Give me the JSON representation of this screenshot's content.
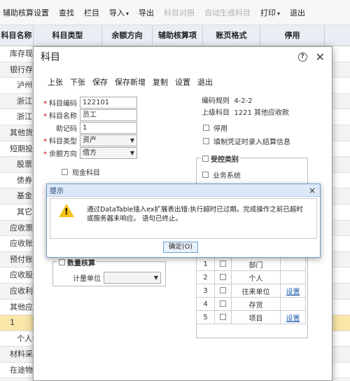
{
  "toolbar": {
    "items": [
      {
        "label": "辅助核算设置",
        "disabled": false,
        "caret": false
      },
      {
        "label": "查找",
        "disabled": false,
        "caret": false
      },
      {
        "label": "栏目",
        "disabled": false,
        "caret": false
      },
      {
        "label": "导入",
        "disabled": false,
        "caret": true
      },
      {
        "label": "导出",
        "disabled": false,
        "caret": false
      },
      {
        "label": "科目对照",
        "disabled": true,
        "caret": false
      },
      {
        "label": "自动生成科目",
        "disabled": true,
        "caret": false
      },
      {
        "label": "打印",
        "disabled": false,
        "caret": true
      },
      {
        "label": "退出",
        "disabled": false,
        "caret": false
      }
    ]
  },
  "grid": {
    "headers": [
      "科目名称",
      "科目类型",
      "余额方向",
      "辅助核算项",
      "账页格式",
      "停用"
    ],
    "rows": [
      "库存现金",
      "银行存款",
      "泸州商业银行",
      "浙江民泰银行",
      "浙江民泰银行",
      "其他货币资金",
      "短期投资",
      "股票",
      "债券",
      "基金",
      "其它",
      "应收票据",
      "应收账款",
      "预付账款",
      "应收股利",
      "应收利息",
      "其他应收款",
      "1",
      "个人往来",
      "材料采购",
      "在途物资",
      "原材料"
    ]
  },
  "dialog": {
    "title": "科目",
    "actions": [
      "上张",
      "下张",
      "保存",
      "保存新增",
      "复制",
      "设置",
      "退出"
    ],
    "form": {
      "code_label": "科目编码",
      "code_value": "122101",
      "name_label": "科目名称",
      "name_value": "员工",
      "mnemonic_label": "助记码",
      "mnemonic_value": "1",
      "type_label": "科目类型",
      "type_value": "资产",
      "direction_label": "余额方向",
      "direction_value": "借方",
      "cash_label": "现金科目"
    },
    "info": {
      "rule_label": "编码规则",
      "rule_value": "4-2-2",
      "parent_label": "上级科目",
      "parent_value": "1221 其他应收款",
      "disable_label": "停用",
      "voucher_label": "填制凭证时录入结算信息"
    },
    "quantity": {
      "group_label": "数量核算",
      "unit_label": "计量单位"
    },
    "control": {
      "group_label": "受控类别",
      "business_label": "业务系统",
      "rows": [
        {
          "num": "1",
          "name": "部门",
          "setting": ""
        },
        {
          "num": "2",
          "name": "个人",
          "setting": ""
        },
        {
          "num": "3",
          "name": "往来单位",
          "setting": "设置"
        },
        {
          "num": "4",
          "name": "存货",
          "setting": ""
        },
        {
          "num": "5",
          "name": "项目",
          "setting": "设置"
        }
      ]
    }
  },
  "alert": {
    "title": "提示",
    "message": "通过DataTable插入ex扩展表出错:执行超时已过期。完成操作之前已超时或服务器未响应。 语句已终止。",
    "ok_label": "确定(O)"
  }
}
